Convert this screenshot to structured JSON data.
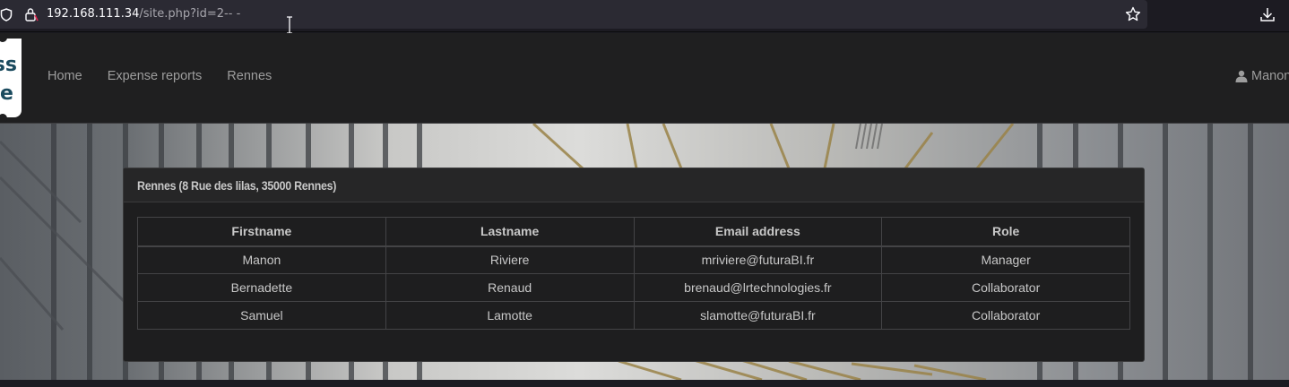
{
  "browser": {
    "url_host": "192.168.111.34",
    "url_path": "/site.php?id=2-- -"
  },
  "navbar": {
    "logo_text_top": "ss",
    "logo_text_bottom": "e",
    "links": [
      "Home",
      "Expense reports",
      "Rennes"
    ],
    "user_name": "Manon"
  },
  "panel": {
    "title": "Rennes (8 Rue des lilas, 35000 Rennes)",
    "table": {
      "headers": [
        "Firstname",
        "Lastname",
        "Email address",
        "Role"
      ],
      "rows": [
        [
          "Manon",
          "Riviere",
          "mriviere@futuraBI.fr",
          "Manager"
        ],
        [
          "Bernadette",
          "Renaud",
          "brenaud@lrtechnologies.fr",
          "Collaborator"
        ],
        [
          "Samuel",
          "Lamotte",
          "slamotte@futuraBI.fr",
          "Collaborator"
        ]
      ]
    }
  },
  "colors": {
    "navbar_bg": "#1f1f20",
    "panel_bg": "#1e1e1f",
    "nav_text": "#9d9d9d",
    "logo_text": "#1a4a5e"
  }
}
